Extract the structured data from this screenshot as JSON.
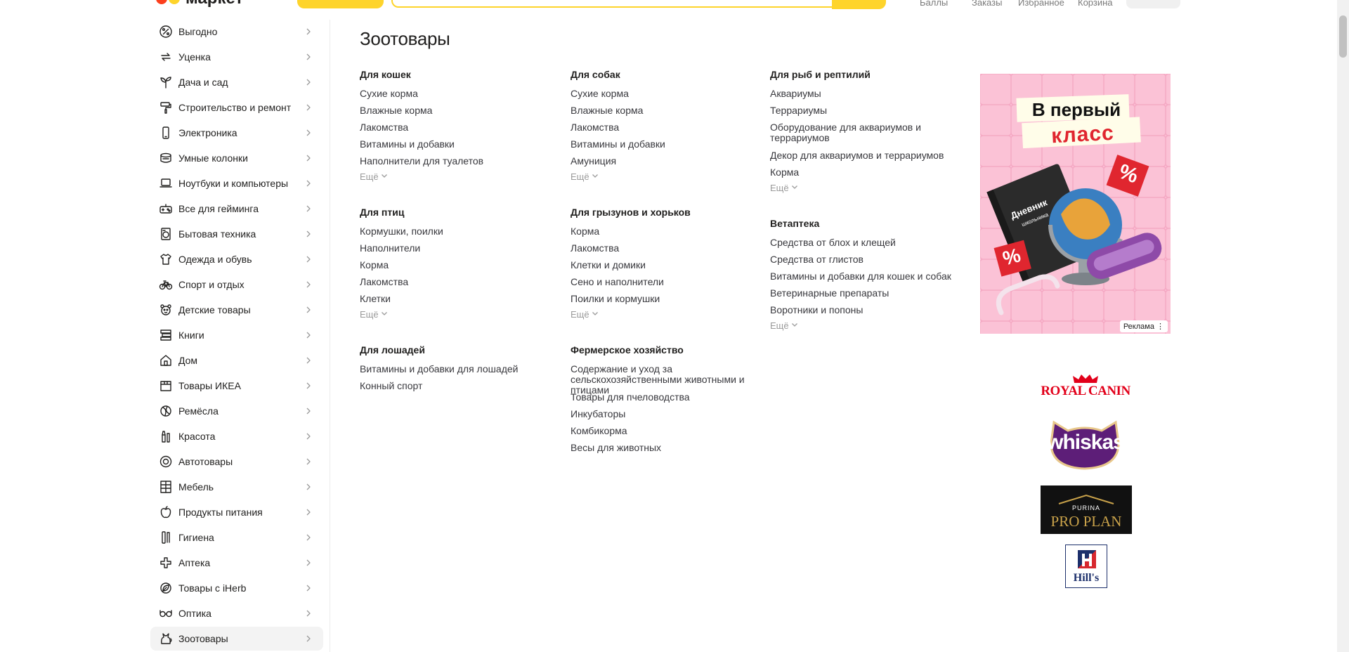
{
  "header": {
    "logo_text": "маркет",
    "links": [
      "Баллы",
      "Заказы",
      "Избранное",
      "Корзина"
    ]
  },
  "sidebar": {
    "items": [
      {
        "label": "Выгодно",
        "icon": "percent-icon"
      },
      {
        "label": "Уценка",
        "icon": "refresh-icon"
      },
      {
        "label": "Дача и сад",
        "icon": "plant-icon"
      },
      {
        "label": "Строительство и ремонт",
        "icon": "paint-roller-icon"
      },
      {
        "label": "Электроника",
        "icon": "smartphone-icon"
      },
      {
        "label": "Умные колонки",
        "icon": "smart-speaker-icon"
      },
      {
        "label": "Ноутбуки и компьютеры",
        "icon": "laptop-icon"
      },
      {
        "label": "Все для гейминга",
        "icon": "gamepad-icon"
      },
      {
        "label": "Бытовая техника",
        "icon": "washing-machine-icon"
      },
      {
        "label": "Одежда и обувь",
        "icon": "tshirt-icon"
      },
      {
        "label": "Спорт и отдых",
        "icon": "bicycle-icon"
      },
      {
        "label": "Детские товары",
        "icon": "teddy-bear-icon"
      },
      {
        "label": "Книги",
        "icon": "books-icon"
      },
      {
        "label": "Дом",
        "icon": "house-icon"
      },
      {
        "label": "Товары ИКЕА",
        "icon": "box-icon"
      },
      {
        "label": "Ремёсла",
        "icon": "yarn-icon"
      },
      {
        "label": "Красота",
        "icon": "cosmetics-icon"
      },
      {
        "label": "Автотовары",
        "icon": "tire-icon"
      },
      {
        "label": "Мебель",
        "icon": "shelf-icon"
      },
      {
        "label": "Продукты питания",
        "icon": "apple-icon"
      },
      {
        "label": "Гигиена",
        "icon": "toothbrush-icon"
      },
      {
        "label": "Аптека",
        "icon": "medical-cross-icon"
      },
      {
        "label": "Товары с iHerb",
        "icon": "leaf-icon"
      },
      {
        "label": "Оптика",
        "icon": "glasses-icon"
      },
      {
        "label": "Зоотовары",
        "icon": "cat-icon",
        "active": true
      }
    ]
  },
  "main": {
    "title": "Зоотовары",
    "more_label": "Ещё",
    "columns": [
      [
        {
          "title": "Для кошек",
          "links": [
            "Сухие корма",
            "Влажные корма",
            "Лакомства",
            "Витамины и добавки",
            "Наполнители для туалетов"
          ],
          "more": true
        },
        {
          "title": "Для птиц",
          "links": [
            "Кормушки, поилки",
            "Наполнители",
            "Корма",
            "Лакомства",
            "Клетки"
          ],
          "more": true
        },
        {
          "title": "Для лошадей",
          "links": [
            "Витамины и добавки для лошадей",
            "Конный спорт"
          ],
          "more": false
        }
      ],
      [
        {
          "title": "Для собак",
          "links": [
            "Сухие корма",
            "Влажные корма",
            "Лакомства",
            "Витамины и добавки",
            "Амуниция"
          ],
          "more": true
        },
        {
          "title": "Для грызунов и хорьков",
          "links": [
            "Корма",
            "Лакомства",
            "Клетки и домики",
            "Сено и наполнители",
            "Поилки и кормушки"
          ],
          "more": true
        },
        {
          "title": "Фермерское хозяйство",
          "links": [
            "Содержание и уход за сельскохозяйственными животными и птицами",
            "Товары для пчеловодства",
            "Инкубаторы",
            "Комбикорма",
            "Весы для животных"
          ],
          "more": false
        }
      ],
      [
        {
          "title": "Для рыб и рептилий",
          "links": [
            "Аквариумы",
            "Террариумы",
            "Оборудование для аквариумов и террариумов",
            "Декор для аквариумов и террариумов",
            "Корма"
          ],
          "more": true
        },
        {
          "title": "Ветаптека",
          "links": [
            "Средства от блох и клещей",
            "Средства от глистов",
            "Витамины и добавки для кошек и собак",
            "Ветеринарные препараты",
            "Воротники и попоны"
          ],
          "more": true
        }
      ]
    ]
  },
  "ad": {
    "headline_line1": "В первый",
    "headline_line2": "класс",
    "notebook_text": "Дневник",
    "notebook_sub": "школьника",
    "badge": "%",
    "tag": "Реклама"
  },
  "brands": {
    "royal_canin": "ROYAL CANIN",
    "whiskas": "whiskas",
    "purina": "PURINA",
    "pro_plan": "PRO PLAN",
    "hills": "Hill's"
  },
  "colors": {
    "accent_yellow": "#fed42b",
    "logo_red": "#fc3f1d",
    "ad_pink": "#fbc2d6",
    "royal_canin_red": "#e2001a",
    "whiskas_purple": "#5d1e78"
  }
}
